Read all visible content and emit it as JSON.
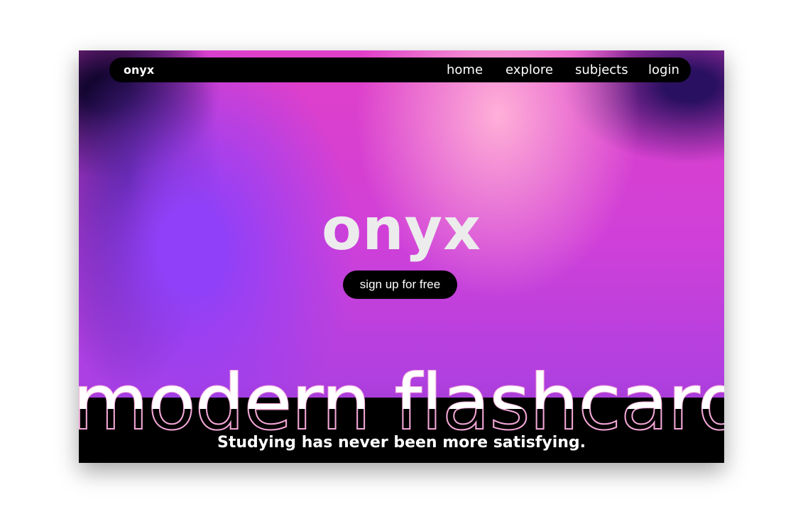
{
  "nav": {
    "logo": "onyx",
    "links": [
      "home",
      "explore",
      "subjects",
      "login"
    ]
  },
  "hero": {
    "title": "onyx",
    "cta": "sign up for free"
  },
  "banner": {
    "headline": "modern flashcards",
    "tagline": "Studying has never been more satisfying."
  }
}
